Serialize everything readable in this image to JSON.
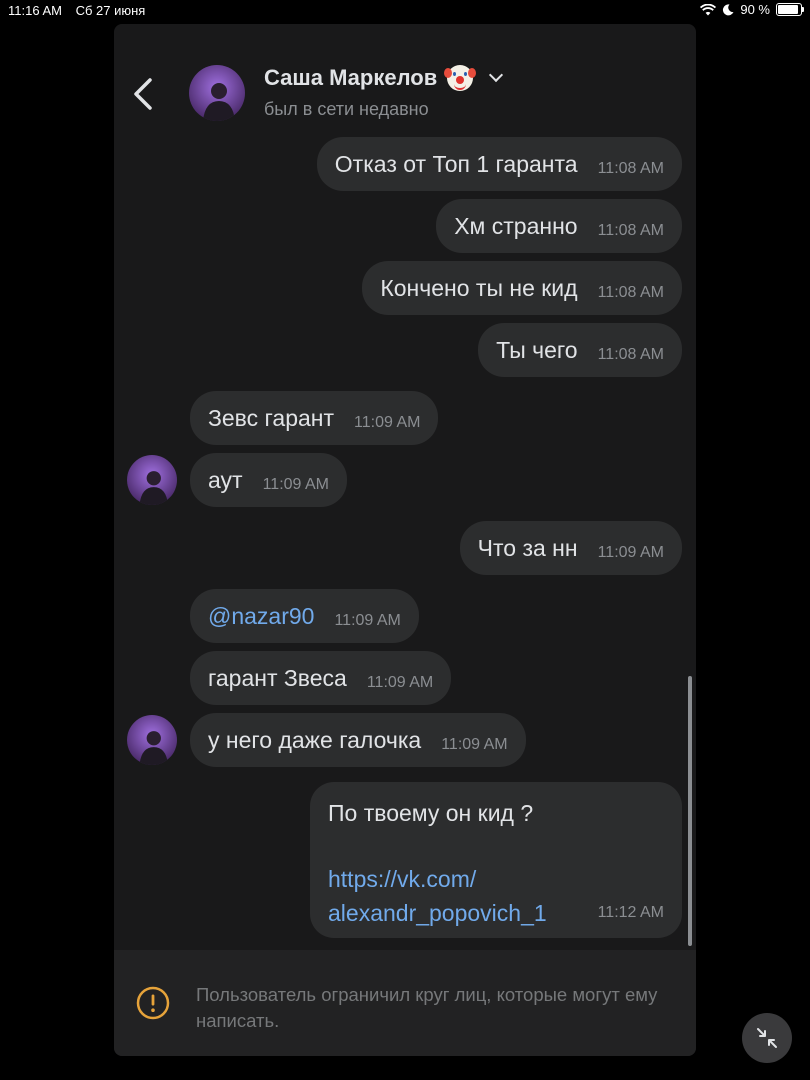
{
  "statusbar": {
    "time": "11:16 AM",
    "date": "Сб 27 июня",
    "battery": "90 %",
    "battery_level": 0.9
  },
  "header": {
    "name": "Саша Маркелов",
    "status": "был в сети недавно"
  },
  "messages": [
    {
      "text": "Отказ от Топ 1 гаранта",
      "time": "11:08 AM",
      "dir": "out"
    },
    {
      "text": "Хм странно",
      "time": "11:08 AM",
      "dir": "out"
    },
    {
      "text": "Кончено ты не кид",
      "time": "11:08 AM",
      "dir": "out"
    },
    {
      "text": "Ты чего",
      "time": "11:08 AM",
      "dir": "out"
    },
    {
      "text": "Зевс гарант",
      "time": "11:09 AM",
      "dir": "in"
    },
    {
      "text": "аут",
      "time": "11:09 AM",
      "dir": "in"
    },
    {
      "text": "Что за нн",
      "time": "11:09 AM",
      "dir": "out"
    },
    {
      "text": "@nazar90",
      "time": "11:09 AM",
      "dir": "in"
    },
    {
      "text": "гарант Звеса",
      "time": "11:09 AM",
      "dir": "in"
    },
    {
      "text": "у него даже галочка",
      "time": "11:09 AM",
      "dir": "in"
    }
  ],
  "last_message": {
    "text": "По твоему он кид ?",
    "link_line1": "https://vk.com/",
    "link_line2": "alexandr_popovich_1",
    "time": "11:12 AM"
  },
  "footer": {
    "notice": "Пользователь ограничил круг лиц, которые могут ему написать."
  },
  "colors": {
    "background": "#19191a",
    "bubble": "#2c2d2e",
    "link": "#71aaeb",
    "warning": "#e6a33a",
    "secondary_text": "#8b8e92"
  },
  "icons": [
    "back-arrow-icon",
    "clown-face-icon",
    "chevron-down-icon",
    "warning-icon",
    "collapse-icon",
    "wifi-icon",
    "moon-icon",
    "battery-icon"
  ]
}
